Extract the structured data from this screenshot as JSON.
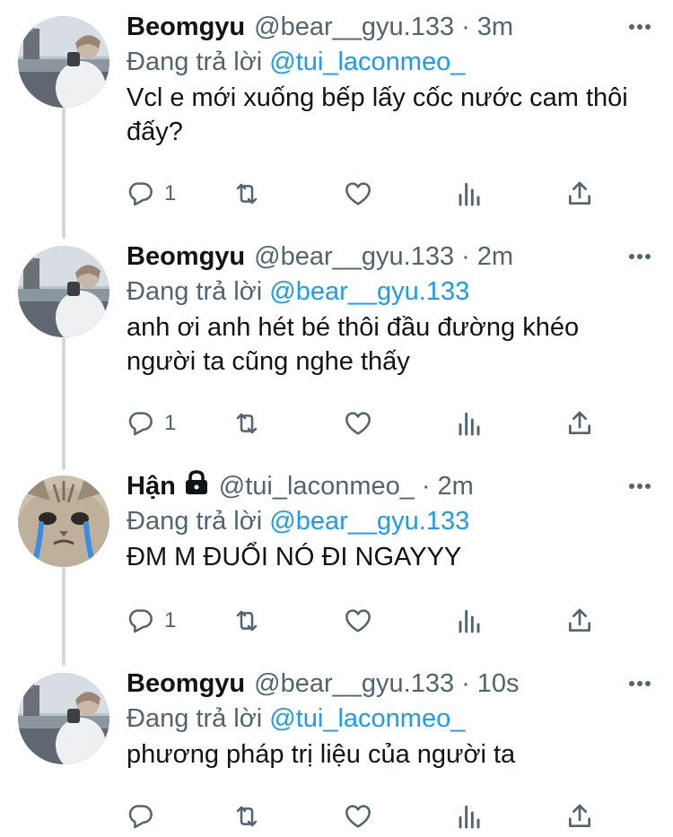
{
  "tweets": [
    {
      "name": "Beomgyu",
      "handle": "@bear__gyu.133",
      "dot": "·",
      "time": "3m",
      "reply_prefix": "Đang trả lời",
      "reply_to": "@tui_laconmeo_",
      "body": "Vcl e mới xuống bếp lấy cốc nước cam thôi đấy?",
      "reply_count": "1",
      "avatar": "person-photo",
      "locked": false
    },
    {
      "name": "Beomgyu",
      "handle": "@bear__gyu.133",
      "dot": "·",
      "time": "2m",
      "reply_prefix": "Đang trả lời",
      "reply_to": "@bear__gyu.133",
      "body": "anh ơi anh hét bé thôi đầu đường khéo người ta cũng nghe thấy",
      "reply_count": "1",
      "avatar": "person-photo",
      "locked": false
    },
    {
      "name": "Hận",
      "handle": "@tui_laconmeo_",
      "dot": "·",
      "time": "2m",
      "reply_prefix": "Đang trả lời",
      "reply_to": "@bear__gyu.133",
      "body": "ĐM M ĐUỔI NÓ ĐI NGAYYY",
      "reply_count": "1",
      "avatar": "crying-cat",
      "locked": true
    },
    {
      "name": "Beomgyu",
      "handle": "@bear__gyu.133",
      "dot": "·",
      "time": "10s",
      "reply_prefix": "Đang trả lời",
      "reply_to": "@tui_laconmeo_",
      "body": "phương pháp trị liệu của người ta",
      "reply_count": "",
      "avatar": "person-photo",
      "locked": false
    }
  ],
  "colors": {
    "text": "#0f1419",
    "secondary": "#536471",
    "link": "#1d9bf0",
    "thread_line": "#cfd9de"
  },
  "icons": [
    "reply-icon",
    "retweet-icon",
    "like-icon",
    "analytics-icon",
    "share-icon",
    "more-icon",
    "lock-icon"
  ]
}
